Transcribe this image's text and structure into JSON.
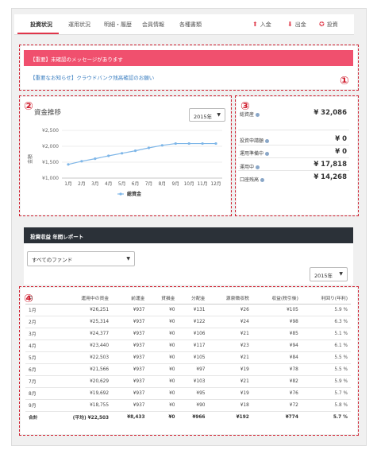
{
  "tabs": [
    {
      "label": "投資状況",
      "active": true
    },
    {
      "label": "運用状況",
      "active": false
    },
    {
      "label": "明細・履歴",
      "active": false
    },
    {
      "label": "会員情報",
      "active": false
    },
    {
      "label": "各種書類",
      "active": false
    }
  ],
  "actions": [
    {
      "label": "入金",
      "icon": "deposit-icon"
    },
    {
      "label": "出金",
      "icon": "withdraw-icon"
    },
    {
      "label": "投資",
      "icon": "invest-icon"
    }
  ],
  "markers": [
    "①",
    "②",
    "③",
    "④"
  ],
  "alert": {
    "title": "【重要】未確認のメッセージがあります",
    "notice": "【重要なお知らせ】クラウドバンク残高確認のお願い"
  },
  "chart_card": {
    "title": "資金推移",
    "year_select": "2015年",
    "legend": "総資金"
  },
  "chart_data": {
    "type": "line",
    "title": "資金推移",
    "ylabel": "金額",
    "categories": [
      "1月",
      "2月",
      "3月",
      "4月",
      "5月",
      "6月",
      "7月",
      "8月",
      "9月",
      "10月",
      "11月",
      "12月"
    ],
    "series": [
      {
        "name": "総資金",
        "values": [
          31430,
          31530,
          31610,
          31700,
          31780,
          31860,
          31950,
          32030,
          32086,
          32086,
          32086,
          32086
        ]
      }
    ],
    "y_ticks": [
      "¥1,000",
      "¥1,500",
      "¥2,000",
      "¥2,500"
    ],
    "ylim": [
      31000,
      32500
    ],
    "color": "#7eb6e8"
  },
  "balance": [
    {
      "label": "総資産",
      "value": "¥ 32,086"
    },
    {
      "label": "投資申請額",
      "value": "¥ 0"
    },
    {
      "label": "運用準備中",
      "value": "¥ 0"
    },
    {
      "label": "運用中",
      "value": "¥ 17,818"
    },
    {
      "label": "口座残高",
      "value": "¥ 14,268"
    }
  ],
  "report": {
    "title": "投資収益 年間レポート",
    "fund_select": "すべてのファンド",
    "year_select": "2015年",
    "headers": [
      "月",
      "運用中の資金",
      "前運金",
      "貸損金",
      "分配金",
      "源泉徴収税",
      "収益(税引後)",
      "利回り(年利)"
    ],
    "rows": [
      [
        "1月",
        "¥26,251",
        "¥937",
        "¥0",
        "¥131",
        "¥26",
        "¥105",
        "5.9 %"
      ],
      [
        "2月",
        "¥25,314",
        "¥937",
        "¥0",
        "¥122",
        "¥24",
        "¥98",
        "6.3 %"
      ],
      [
        "3月",
        "¥24,377",
        "¥937",
        "¥0",
        "¥106",
        "¥21",
        "¥85",
        "5.1 %"
      ],
      [
        "4月",
        "¥23,440",
        "¥937",
        "¥0",
        "¥117",
        "¥23",
        "¥94",
        "6.1 %"
      ],
      [
        "5月",
        "¥22,503",
        "¥937",
        "¥0",
        "¥105",
        "¥21",
        "¥84",
        "5.5 %"
      ],
      [
        "6月",
        "¥21,566",
        "¥937",
        "¥0",
        "¥97",
        "¥19",
        "¥78",
        "5.5 %"
      ],
      [
        "7月",
        "¥20,629",
        "¥937",
        "¥0",
        "¥103",
        "¥21",
        "¥82",
        "5.9 %"
      ],
      [
        "8月",
        "¥19,692",
        "¥937",
        "¥0",
        "¥95",
        "¥19",
        "¥76",
        "5.7 %"
      ],
      [
        "9月",
        "¥18,755",
        "¥937",
        "¥0",
        "¥90",
        "¥18",
        "¥72",
        "5.8 %"
      ]
    ],
    "total": [
      "合計",
      "(平均) ¥22,503",
      "¥8,433",
      "¥0",
      "¥966",
      "¥192",
      "¥774",
      "5.7 %"
    ]
  }
}
